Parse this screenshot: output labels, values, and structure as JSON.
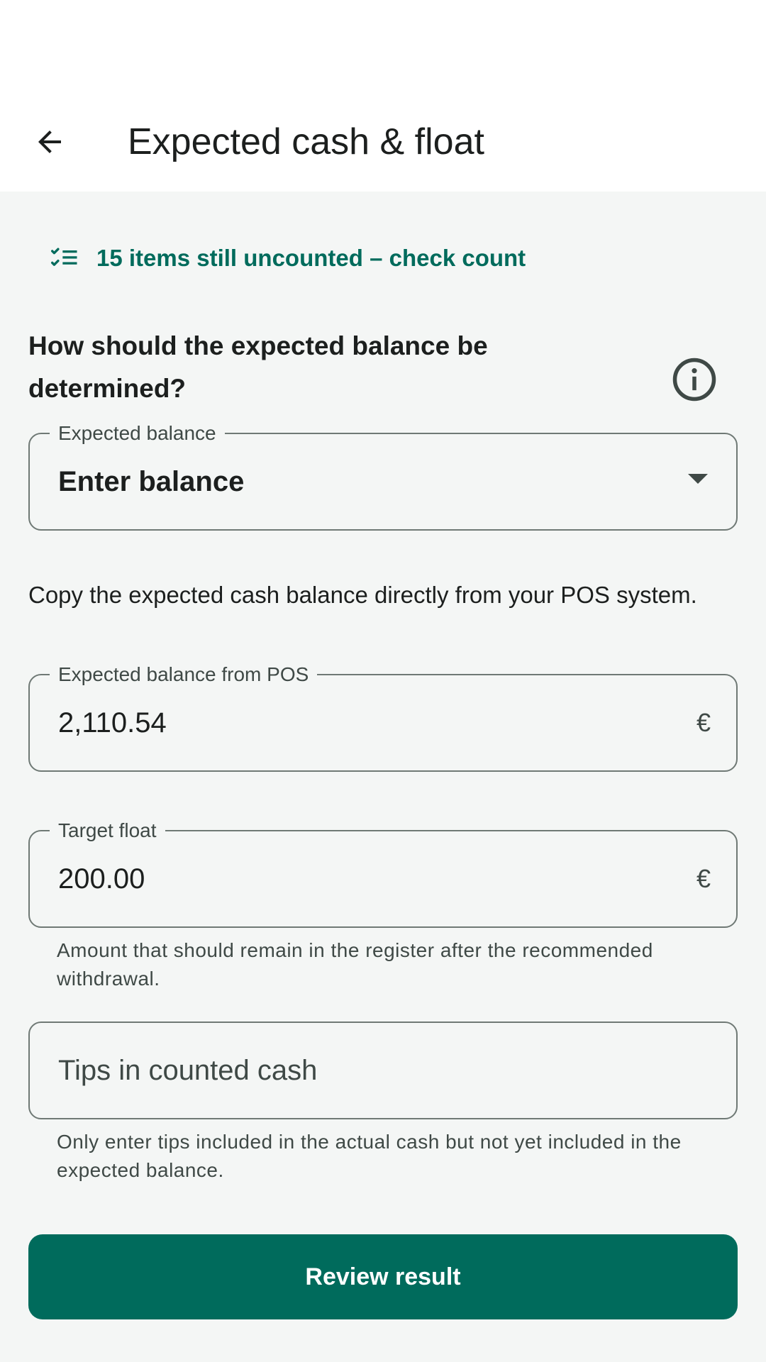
{
  "app_bar": {
    "title": "Expected cash & float",
    "back_icon": "arrow-back-icon"
  },
  "warning": {
    "icon": "checklist-icon",
    "text": "15 items still uncounted – check count",
    "color": "#006b5c"
  },
  "question": {
    "text": "How should the expected balance be determined?",
    "info_icon": "info-icon"
  },
  "expected_balance": {
    "label": "Expected balance",
    "selected": "Enter balance"
  },
  "description": "Copy the expected cash balance directly from your POS system.",
  "pos_balance": {
    "label": "Expected balance from POS",
    "value": "2,110.54",
    "currency": "€"
  },
  "target_float": {
    "label": "Target float",
    "value": "200.00",
    "currency": "€",
    "helper": "Amount that should remain in the register after the recommended withdrawal."
  },
  "tips": {
    "placeholder": "Tips in counted cash",
    "helper": "Only enter tips included in the actual cash but not yet included in the expected balance."
  },
  "actions": {
    "primary_label": "Review result",
    "primary_color": "#006b5c"
  }
}
